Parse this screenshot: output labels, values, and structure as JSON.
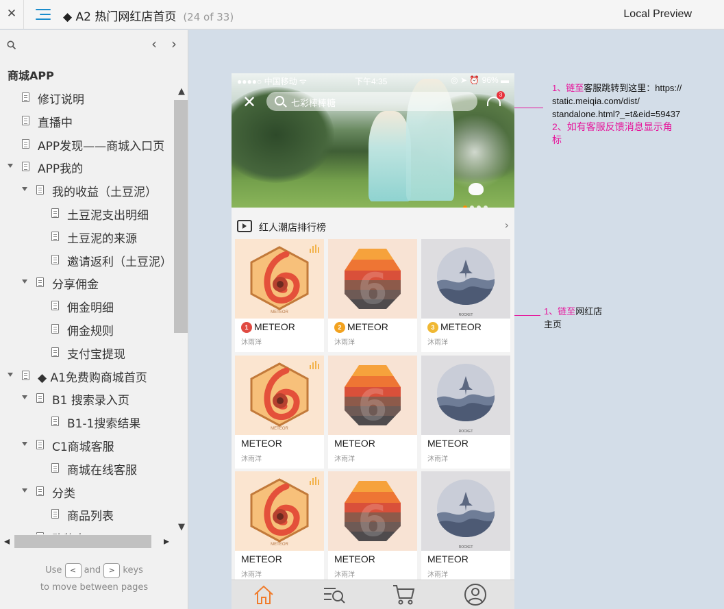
{
  "topbar": {
    "close": "✕",
    "title": "◆ A2 热门网红店首页",
    "count": "(24 of 33)",
    "preview": "Local Preview"
  },
  "sidebar": {
    "section": "商城APP",
    "items": [
      {
        "label": "修订说明",
        "level": 1,
        "expanded": false
      },
      {
        "label": "直播中",
        "level": 1,
        "expanded": false
      },
      {
        "label": "APP发现——商城入口页",
        "level": 1,
        "expanded": false
      },
      {
        "label": "APP我的",
        "level": 1,
        "expanded": true
      },
      {
        "label": "我的收益（土豆泥）",
        "level": 2,
        "expanded": true
      },
      {
        "label": "土豆泥支出明细",
        "level": 3,
        "expanded": false
      },
      {
        "label": "土豆泥的来源",
        "level": 3,
        "expanded": false
      },
      {
        "label": "邀请返利（土豆泥）",
        "level": 3,
        "expanded": false
      },
      {
        "label": "分享佣金",
        "level": 2,
        "expanded": true
      },
      {
        "label": "佣金明细",
        "level": 3,
        "expanded": false
      },
      {
        "label": "佣金规则",
        "level": 3,
        "expanded": false
      },
      {
        "label": "支付宝提现",
        "level": 3,
        "expanded": false
      },
      {
        "label": "◆ A1免费购商城首页",
        "level": 1,
        "expanded": true
      },
      {
        "label": "B1 搜索录入页",
        "level": 2,
        "expanded": true
      },
      {
        "label": "B1-1搜索结果",
        "level": 3,
        "expanded": false
      },
      {
        "label": "C1商城客服",
        "level": 2,
        "expanded": true
      },
      {
        "label": "商城在线客服",
        "level": 3,
        "expanded": false
      },
      {
        "label": "分类",
        "level": 2,
        "expanded": true
      },
      {
        "label": "商品列表",
        "level": 3,
        "expanded": false
      },
      {
        "label": "购物车",
        "level": 2,
        "expanded": false
      }
    ],
    "help_use": "Use",
    "help_and": "and",
    "help_keys": "keys",
    "help_line2": "to move between pages",
    "key_prev": "<",
    "key_next": ">"
  },
  "phone": {
    "status": {
      "carrier": "●●●●○ 中国移动 ᯤ",
      "time": "下午4:35",
      "battery": "◎ ➤ ⏰ 96% ▬"
    },
    "search_placeholder": "七彩棒棒糖",
    "service_badge": "3",
    "section_title": "红人潮店排行榜",
    "cards": [
      {
        "type": "meteor",
        "name": "METEOR",
        "author": "沐雨洋",
        "rank": "1"
      },
      {
        "type": "six",
        "name": "METEOR",
        "author": "沐雨洋",
        "rank": "2"
      },
      {
        "type": "rocket",
        "name": "METEOR",
        "author": "沐雨洋",
        "rank": "3"
      },
      {
        "type": "meteor",
        "name": "METEOR",
        "author": "沐雨洋",
        "rank": ""
      },
      {
        "type": "six",
        "name": "METEOR",
        "author": "沐雨洋",
        "rank": ""
      },
      {
        "type": "rocket",
        "name": "METEOR",
        "author": "沐雨洋",
        "rank": ""
      },
      {
        "type": "meteor",
        "name": "METEOR",
        "author": "沐雨洋",
        "rank": ""
      },
      {
        "type": "six",
        "name": "METEOR",
        "author": "沐雨洋",
        "rank": ""
      },
      {
        "type": "rocket",
        "name": "METEOR",
        "author": "沐雨洋",
        "rank": ""
      }
    ],
    "meteor_logo_text": "METEOR",
    "rocket_logo_text": "ROCKET",
    "tabs": [
      "home-icon",
      "list-search-icon",
      "cart-icon",
      "user-icon"
    ]
  },
  "annotations": {
    "service": {
      "num": "1、",
      "link": "链至",
      "text1": "客服跳转到这里：https://",
      "text2": "static.meiqia.com/dist/",
      "text3": "standalone.html?_=t&eid=59437",
      "line2a": "2、如有客服反馈消息显示角",
      "line2b": "标"
    },
    "shop": {
      "num": "1、",
      "link": "链至",
      "text1": "网红店",
      "text2": "主页"
    }
  },
  "colors": {
    "accent": "#1a8ccc",
    "annotation": "#e6139a",
    "tab_active": "#f07c2c"
  }
}
